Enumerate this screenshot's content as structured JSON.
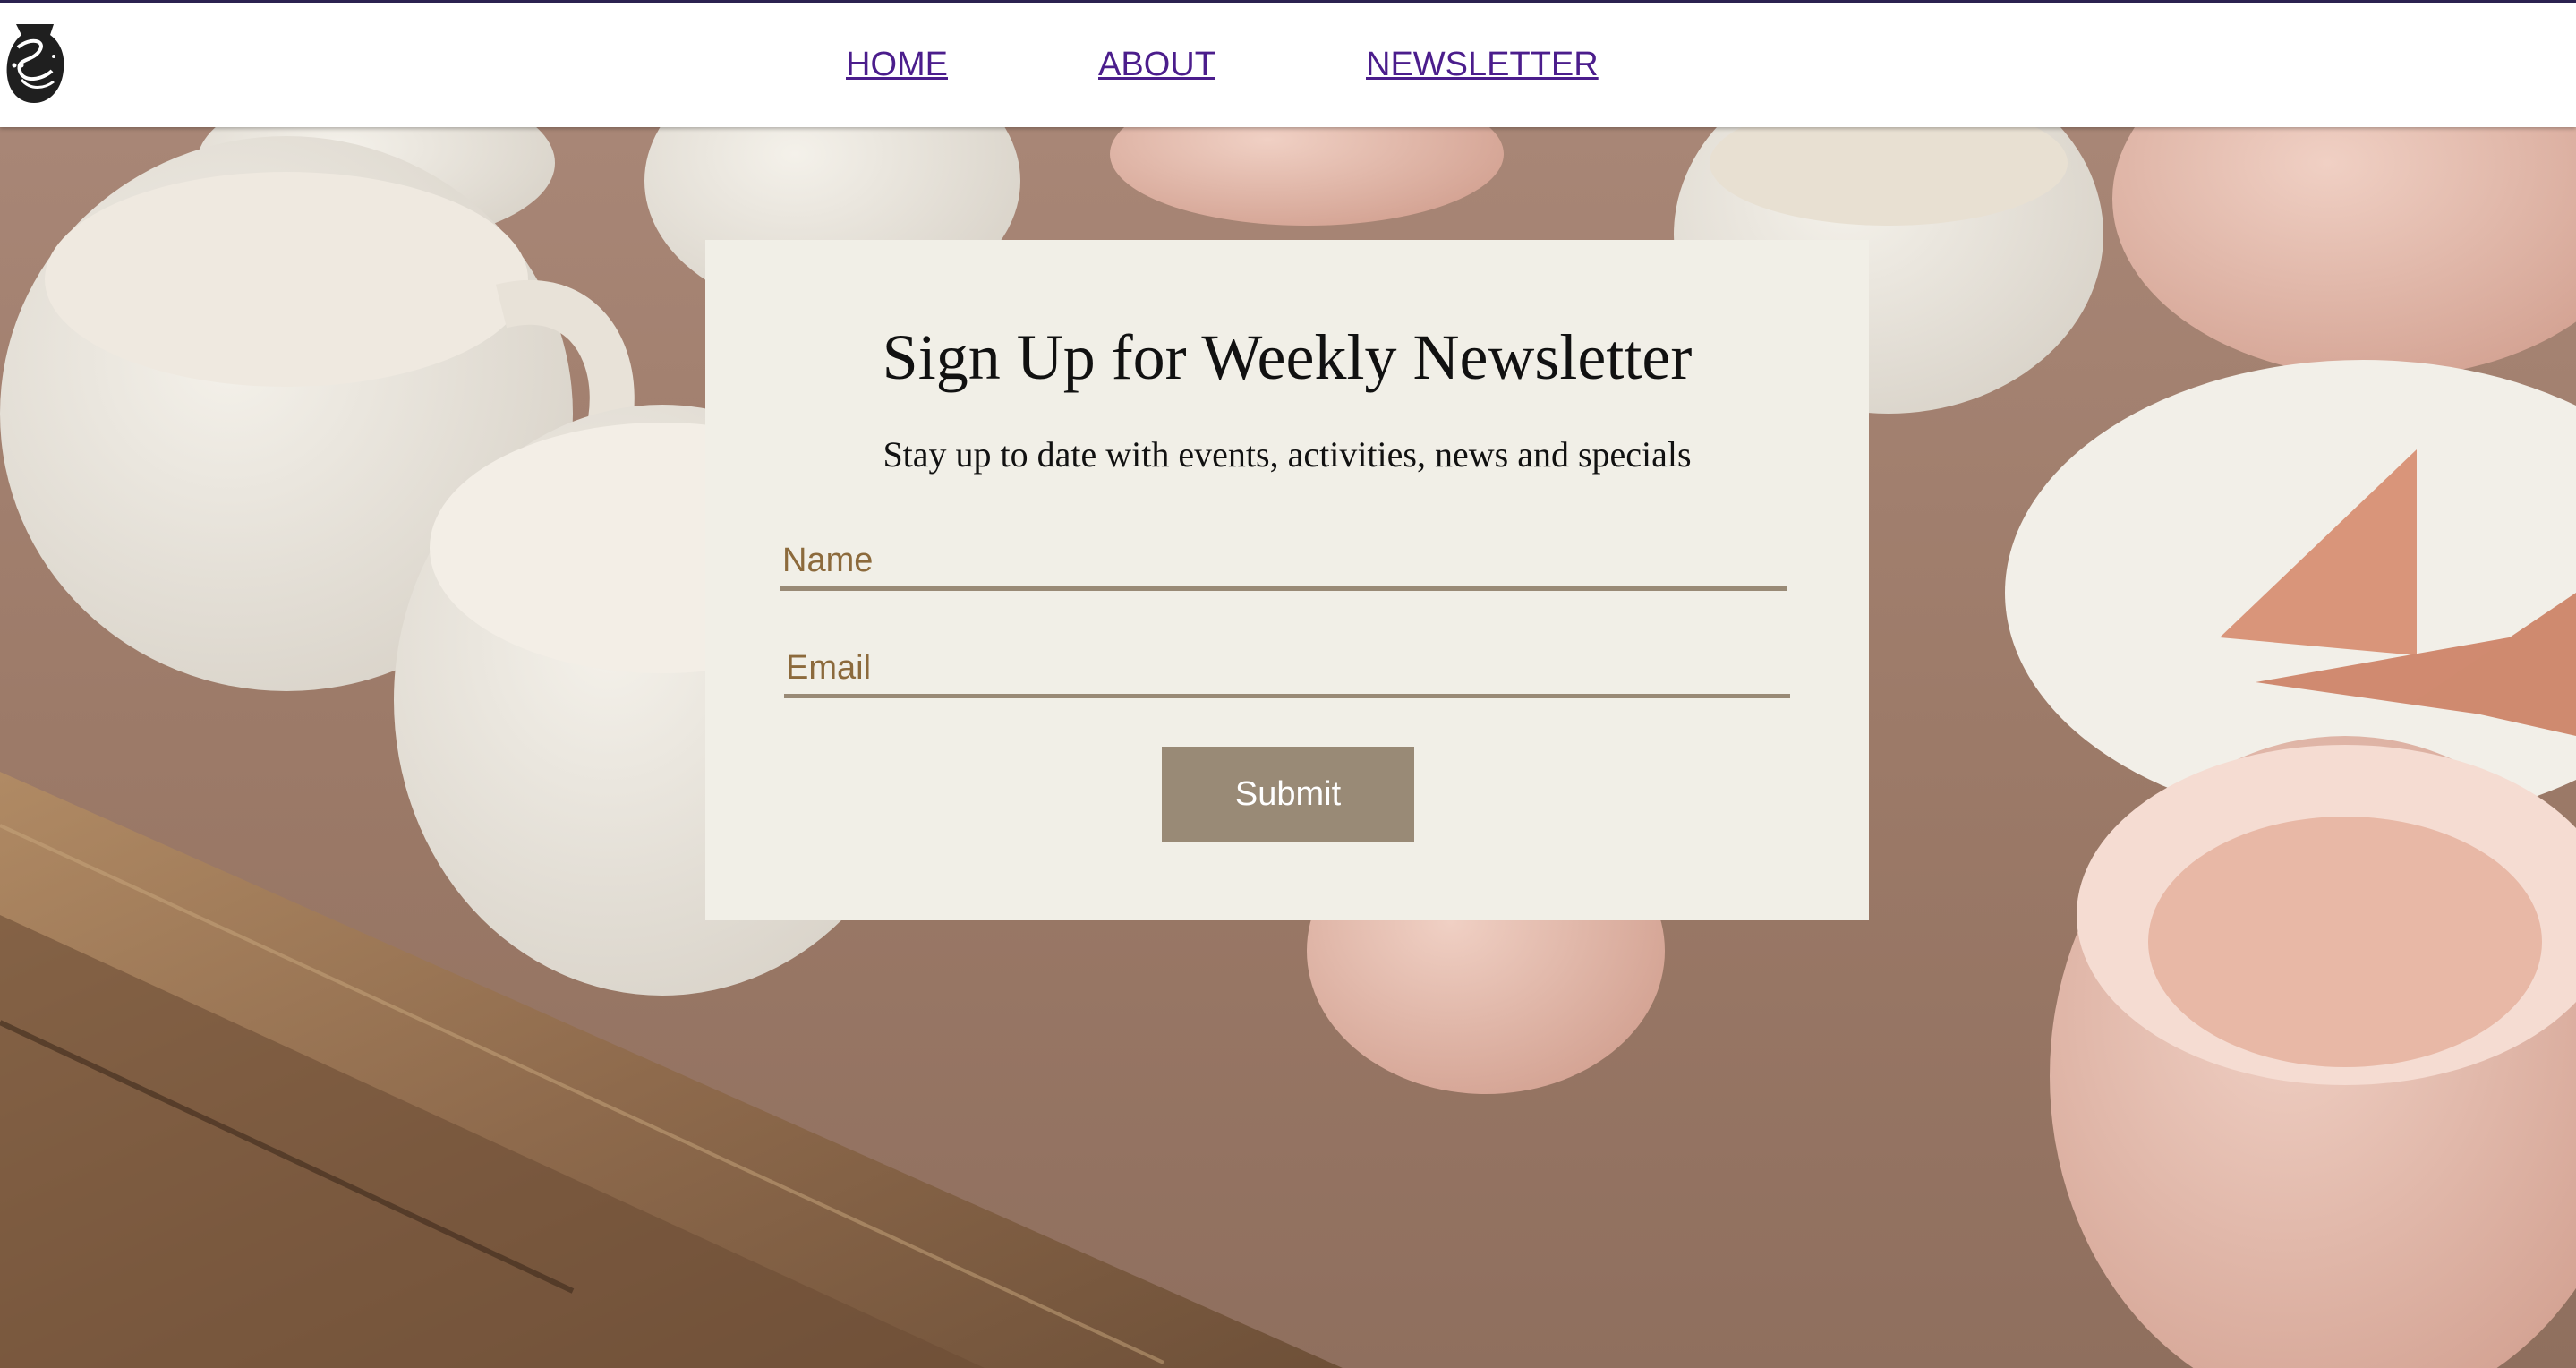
{
  "nav": {
    "home": "HOME",
    "about": "ABOUT",
    "newsletter": "NEWSLETTER"
  },
  "signup": {
    "title": "Sign Up for Weekly Newsletter",
    "subtitle": "Stay up to date with events, activities, news and specials",
    "name_placeholder": "Name",
    "email_placeholder": "Email",
    "submit_label": "Submit"
  },
  "colors": {
    "nav_link": "#4b1d8c",
    "card_bg": "#f1efe7",
    "accent": "#998a76",
    "placeholder": "#8c6a3c"
  }
}
